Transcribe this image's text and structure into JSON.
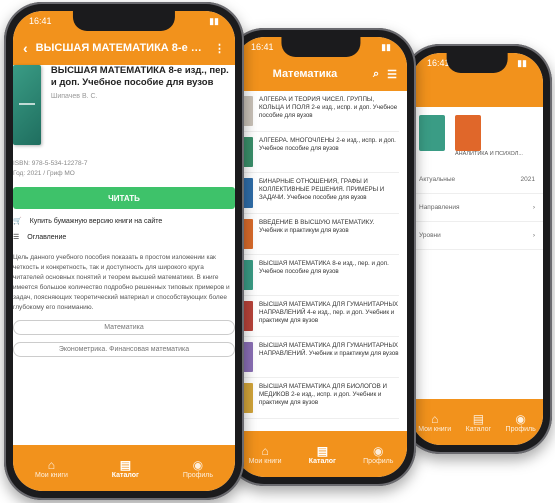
{
  "phone1": {
    "status_time": "16:41",
    "title": "ВЫСШАЯ МАТЕМАТИКА 8-е изд...",
    "book_title": "ВЫСШАЯ МАТЕМАТИКА 8-е изд., пер. и доп. Учебное пособие для вузов",
    "book_author": "Шипачев В. С.",
    "meta_isbn": "ISBN: 978-5-534-12278-7",
    "meta_year": "Год: 2021 / Гриф МО",
    "read_label": "ЧИТАТЬ",
    "buy_label": "Купить бумажную версию книги на сайте",
    "toc_label": "Оглавление",
    "description": "Цель данного учебного пособия показать в простом изложении как четкость и конкретность, так и доступность для широкого круга читателей основных понятий и теорем высшей математики. В книге имеется большое количество подробно решенных типовых примеров и задач, поясняющих теоретический материал и способствующих более глубокому его пониманию.",
    "chips": [
      "Математика",
      "Эконометрика. Финансовая математика"
    ],
    "tabs": [
      {
        "label": "Мои книги",
        "icon": "home-icon"
      },
      {
        "label": "Каталог",
        "icon": "catalog-icon"
      },
      {
        "label": "Профиль",
        "icon": "profile-icon"
      }
    ]
  },
  "phone2": {
    "status_time": "16:41",
    "title": "Математика",
    "items": [
      {
        "title": "АЛГЕБРА И ТЕОРИЯ ЧИСЕЛ. ГРУППЫ, КОЛЬЦА И ПОЛЯ 2-е изд., испр. и доп. Учебное пособие для вузов",
        "color": "#c9c2b8"
      },
      {
        "title": "АЛГЕБРА. МНОГОЧЛЕНЫ 2-е изд., испр. и доп. Учебное пособие для вузов",
        "color": "#3a8f6a"
      },
      {
        "title": "БИНАРНЫЕ ОТНОШЕНИЯ, ГРАФЫ И КОЛЛЕКТИВНЫЕ РЕШЕНИЯ. ПРИМЕРЫ И ЗАДАЧИ. Учебное пособие для вузов",
        "color": "#2f6da8"
      },
      {
        "title": "ВВЕДЕНИЕ В ВЫСШУЮ МАТЕМАТИКУ. Учебник и практикум для вузов",
        "color": "#d96b2b"
      },
      {
        "title": "ВЫСШАЯ МАТЕМАТИКА 8-е изд., пер. и доп. Учебное пособие для вузов",
        "color": "#3a9c85"
      },
      {
        "title": "ВЫСШАЯ МАТЕМАТИКА ДЛЯ ГУМАНИТАРНЫХ НАПРАВЛЕНИЙ 4-е изд., пер. и доп. Учебник и практикум для вузов",
        "color": "#b8433a"
      },
      {
        "title": "ВЫСШАЯ МАТЕМАТИКА ДЛЯ ГУМАНИТАРНЫХ НАПРАВЛЕНИЙ. Учебник и практикум для вузов",
        "color": "#8a6fb5"
      },
      {
        "title": "ВЫСШАЯ МАТЕМАТИКА ДЛЯ БИОЛОГОВ И МЕДИКОВ 2-е изд., испр. и доп. Учебник и практикум для вузов",
        "color": "#d2a53a"
      }
    ],
    "tabs": [
      {
        "label": "Мои книги",
        "icon": "home-icon"
      },
      {
        "label": "Каталог",
        "icon": "catalog-icon"
      },
      {
        "label": "Профиль",
        "icon": "profile-icon"
      }
    ]
  },
  "phone3": {
    "status_time": "16:41",
    "books": [
      {
        "title": "",
        "color": "#3a9c85"
      },
      {
        "title": "АНАЛИТИКА И ПСИХОЛ...",
        "color": "#e0672a"
      }
    ],
    "options": [
      {
        "label": "Актуальные",
        "value": "2021"
      },
      {
        "label": "Направления",
        "value": "›"
      },
      {
        "label": "Уровни",
        "value": "›"
      }
    ],
    "tabs": [
      {
        "label": "Мои книги",
        "icon": "home-icon"
      },
      {
        "label": "Каталог",
        "icon": "catalog-icon"
      },
      {
        "label": "Профиль",
        "icon": "profile-icon"
      }
    ]
  },
  "colors": {
    "accent": "#f2921c",
    "read_button": "#3ec26a"
  }
}
